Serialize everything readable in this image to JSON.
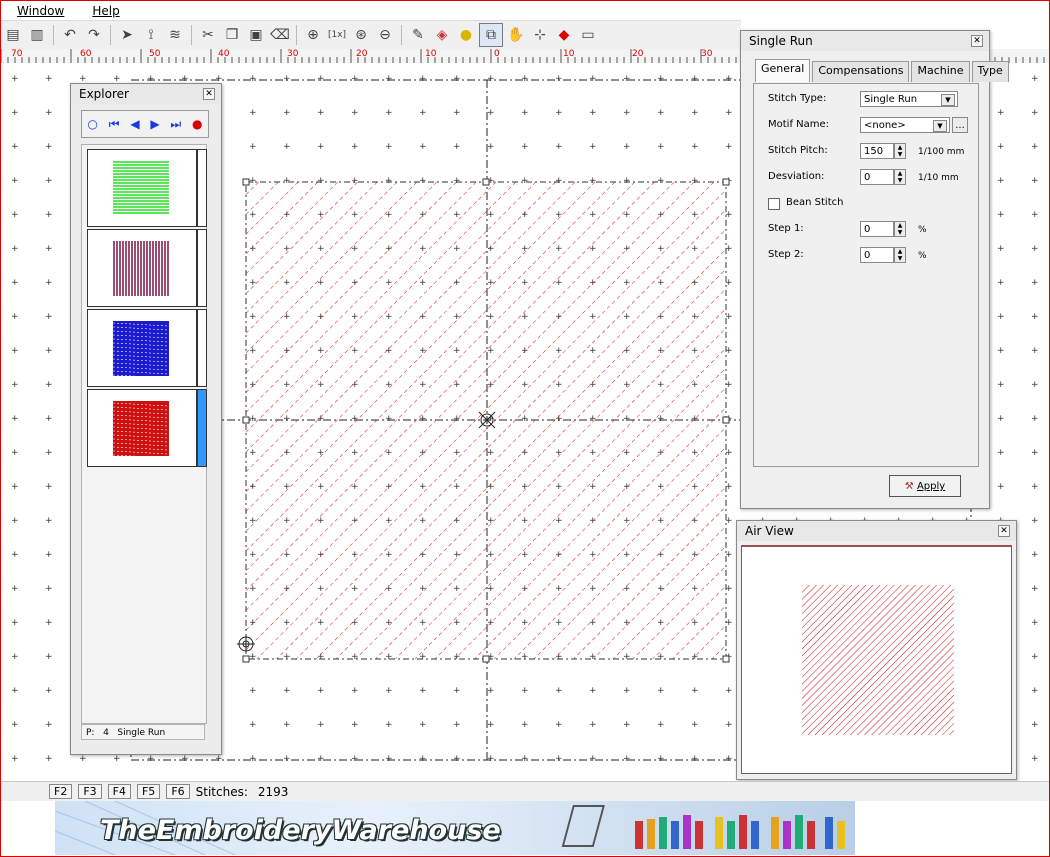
{
  "menu": {
    "window_label": "Window",
    "help_label": "Help"
  },
  "toolbar_icons": [
    "save-icon",
    "book-icon",
    "undo-icon",
    "redo-icon",
    "pointer-icon",
    "node-edit-icon",
    "stitch-icon",
    "cut-icon",
    "copy-icon",
    "paste-icon",
    "eraser-icon",
    "zoom-icon",
    "zoom-1x-icon",
    "zoom-fit-icon",
    "zoom-out-icon",
    "pencil-icon",
    "color-icon",
    "bulb-icon",
    "zoom-window-icon",
    "hand-icon",
    "crosshair-icon",
    "point-icon",
    "ruler-icon"
  ],
  "ruler": {
    "labels": [
      "70",
      "60",
      "50",
      "40",
      "30",
      "20",
      "10",
      "0",
      "10",
      "20",
      "30",
      "40",
      "50",
      "60",
      "70"
    ]
  },
  "explorer": {
    "title": "Explorer",
    "items": [
      {
        "color": "#22dd22",
        "pattern": "horizontal"
      },
      {
        "color": "#7a1040",
        "pattern": "vertical"
      },
      {
        "color": "#1a1ad0",
        "pattern": "fill"
      },
      {
        "color": "#d01010",
        "pattern": "fill"
      }
    ],
    "status_p": "P:",
    "status_num": "4",
    "status_type": "Single Run"
  },
  "single_run": {
    "title": "Single Run",
    "tabs": [
      "General",
      "Compensations",
      "Machine",
      "Type"
    ],
    "stitch_type_label": "Stitch Type:",
    "stitch_type_value": "Single Run",
    "motif_name_label": "Motif Name:",
    "motif_name_value": "<none>",
    "motif_browse": "...",
    "stitch_pitch_label": "Stitch Pitch:",
    "stitch_pitch_value": "150",
    "stitch_pitch_unit": "1/100 mm",
    "deviation_label": "Desviation:",
    "deviation_value": "0",
    "deviation_unit": "1/10 mm",
    "bean_stitch_label": "Bean Stitch",
    "step1_label": "Step 1:",
    "step1_value": "0",
    "step1_unit": "%",
    "step2_label": "Step 2:",
    "step2_value": "0",
    "step2_unit": "%",
    "apply_label": "Apply"
  },
  "air_view": {
    "title": "Air View"
  },
  "status": {
    "fkeys": [
      "F2",
      "F3",
      "F4",
      "F5",
      "F6"
    ],
    "stitches_label": "Stitches:",
    "stitches_value": "2193"
  },
  "banner": {
    "text": "TheEmbroideryWarehouse"
  },
  "colors": {
    "stitch_red": "#d01010",
    "selection_blue": "#3399ff"
  }
}
